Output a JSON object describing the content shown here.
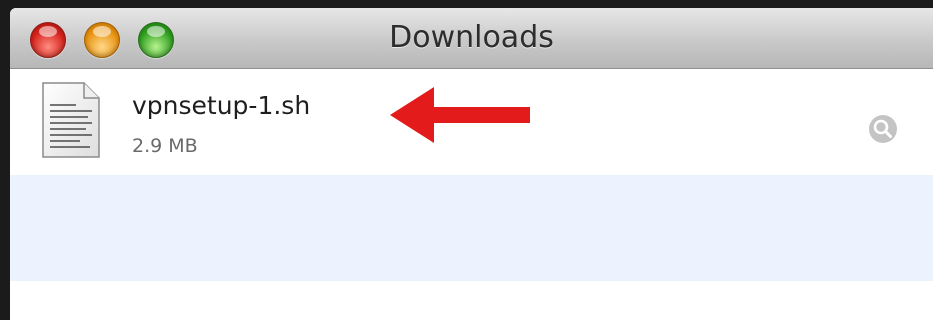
{
  "window": {
    "title": "Downloads",
    "controls": [
      "close",
      "minimize",
      "zoom"
    ]
  },
  "downloads": [
    {
      "name": "vpnsetup-1.sh",
      "size": "2.9 MB",
      "icon": "shell-script-document-icon",
      "action_icon": "magnifier-reveal-icon"
    }
  ],
  "annotation": {
    "type": "arrow",
    "direction": "left",
    "color": "#e31b1b"
  },
  "colors": {
    "alternate_row": "#edf3fe",
    "title_text": "#2d2d2d",
    "size_text": "#6a6a6a"
  }
}
